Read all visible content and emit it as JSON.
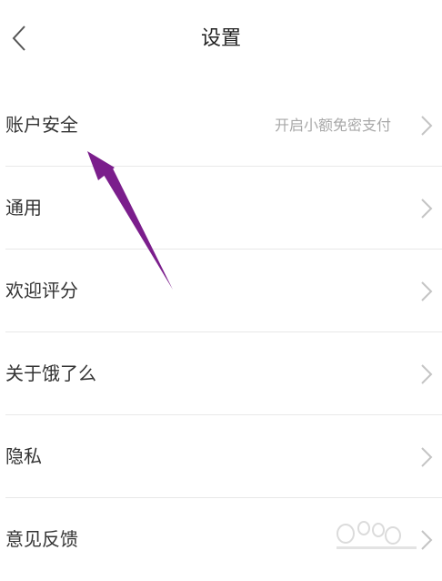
{
  "header": {
    "title": "设置",
    "back_icon": "chevron-left-icon"
  },
  "settings": {
    "items": [
      {
        "label": "账户安全",
        "value": "开启小额免密支付"
      },
      {
        "label": "通用",
        "value": ""
      },
      {
        "label": "欢迎评分",
        "value": ""
      },
      {
        "label": "关于饿了么",
        "value": ""
      },
      {
        "label": "隐私",
        "value": ""
      },
      {
        "label": "意见反馈",
        "value": ""
      }
    ],
    "chevron_icon": "chevron-right-icon"
  },
  "colors": {
    "background": "#ffffff",
    "text": "#333333",
    "secondary_text": "#a8a8a8",
    "divider": "#e8e8e8",
    "chevron": "#c4c4c4",
    "annotation_arrow": "#7b1e8c"
  }
}
